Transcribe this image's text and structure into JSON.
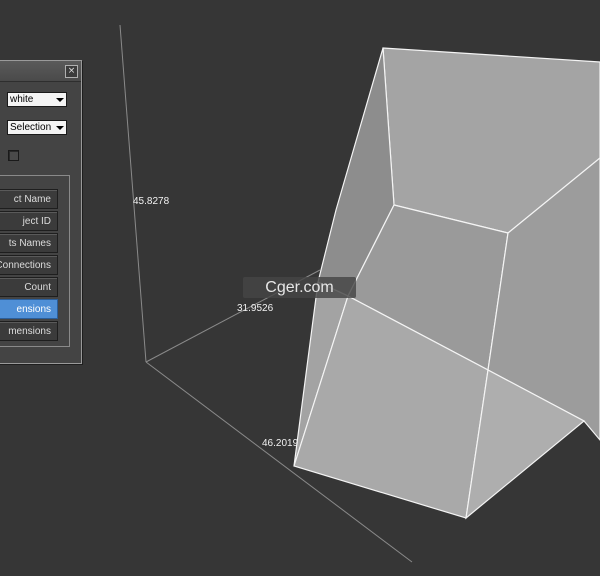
{
  "viewport": {
    "background": "#363636",
    "watermark": "Cger.com",
    "dimension_labels": {
      "height": "45.8278",
      "depth": "31.9526",
      "width": "46.2019"
    }
  },
  "panel": {
    "close_label": "×",
    "color_dropdown": {
      "value": "white"
    },
    "mode_dropdown": {
      "value": "Selection"
    },
    "buttons": [
      {
        "label": "ct Name",
        "active": false
      },
      {
        "label": "ject ID",
        "active": false
      },
      {
        "label": "ts Names",
        "active": false
      },
      {
        "label": "Connections",
        "active": false
      },
      {
        "label": "Count",
        "active": false
      },
      {
        "label": "ensions",
        "active": true
      },
      {
        "label": "mensions",
        "active": false
      }
    ],
    "active_color": "#4f8fd6"
  }
}
